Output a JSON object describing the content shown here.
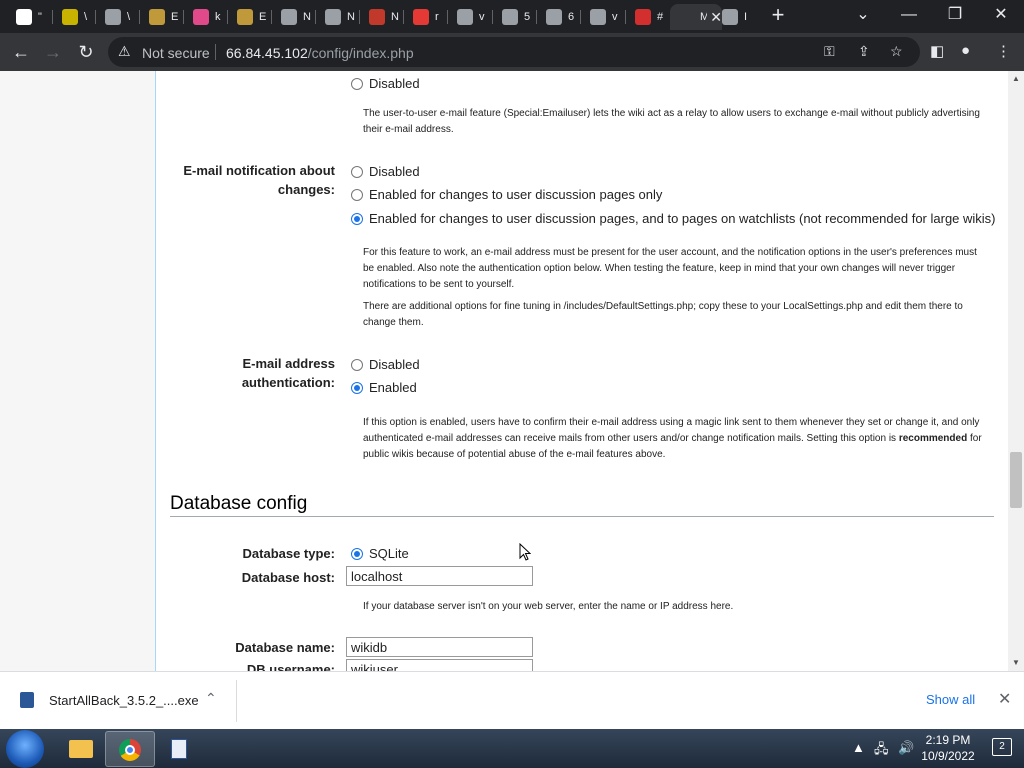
{
  "tabs": [
    {
      "label": "\"",
      "color": "#ffffff"
    },
    {
      "label": "\\",
      "color": "#c8b400"
    },
    {
      "label": "\\",
      "color": "#9aa0a6"
    },
    {
      "label": "E",
      "color": "#c09a3a"
    },
    {
      "label": "k",
      "color": "#e04a8a"
    },
    {
      "label": "E",
      "color": "#c09a3a"
    },
    {
      "label": "N",
      "color": "#9aa0a6"
    },
    {
      "label": "N",
      "color": "#9aa0a6"
    },
    {
      "label": "N",
      "color": "#c0392b"
    },
    {
      "label": "r",
      "color": "#e53935"
    },
    {
      "label": "v",
      "color": "#9aa0a6"
    },
    {
      "label": "5",
      "color": "#9aa0a6"
    },
    {
      "label": "6",
      "color": "#9aa0a6"
    },
    {
      "label": "v",
      "color": "#9aa0a6"
    },
    {
      "label": "#",
      "color": "#d32f2f"
    },
    {
      "label": "M",
      "color": "#35363a"
    },
    {
      "label": "I",
      "color": "#9aa0a6"
    }
  ],
  "toolbar": {
    "not_secure": "Not secure",
    "url_host": "66.84.45.102",
    "url_path": "/config/index.php"
  },
  "page": {
    "user_email_disabled": "Disabled",
    "user_email_help": "The user-to-user e-mail feature (Special:Emailuser) lets the wiki act as a relay to allow users to exchange e-mail without publicly advertising their e-mail address.",
    "notif_label": "E-mail notification about changes:",
    "notif_options": [
      {
        "label": "Disabled",
        "checked": false
      },
      {
        "label": "Enabled for changes to user discussion pages only",
        "checked": false
      },
      {
        "label": "Enabled for changes to user discussion pages, and to pages on watchlists (not recommended for large wikis)",
        "checked": true
      }
    ],
    "notif_help_1": "For this feature to work, an e-mail address must be present for the user account, and the notification options in the user's preferences must be enabled. Also note the authentication option below. When testing the feature, keep in mind that your own changes will never trigger notifications to be sent to yourself.",
    "notif_help_2": "There are additional options for fine tuning in /includes/DefaultSettings.php; copy these to your LocalSettings.php and edit them there to change them.",
    "auth_label": "E-mail address authentication:",
    "auth_options": [
      {
        "label": "Disabled",
        "checked": false
      },
      {
        "label": "Enabled",
        "checked": true
      }
    ],
    "auth_help_pre": "If this option is enabled, users have to confirm their e-mail address using a magic link sent to them whenever they set or change it, and only authenticated e-mail addresses can receive mails from other users and/or change notification mails. Setting this option is ",
    "auth_help_bold": "recommended",
    "auth_help_post": " for public wikis because of potential abuse of the e-mail features above.",
    "db_heading": "Database config",
    "db_type_label": "Database type:",
    "db_type_value": "SQLite",
    "db_host_label": "Database host:",
    "db_host_value": "localhost",
    "db_host_help": "If your database server isn't on your web server, enter the name or IP address here.",
    "db_name_label": "Database name:",
    "db_name_value": "wikidb",
    "db_user_label": "DB username:",
    "db_user_value": "wikiuser"
  },
  "download": {
    "filename": "StartAllBack_3.5.2_....exe",
    "show_all": "Show all"
  },
  "taskbar": {
    "time": "2:19 PM",
    "date": "10/9/2022",
    "notifications": "2"
  }
}
